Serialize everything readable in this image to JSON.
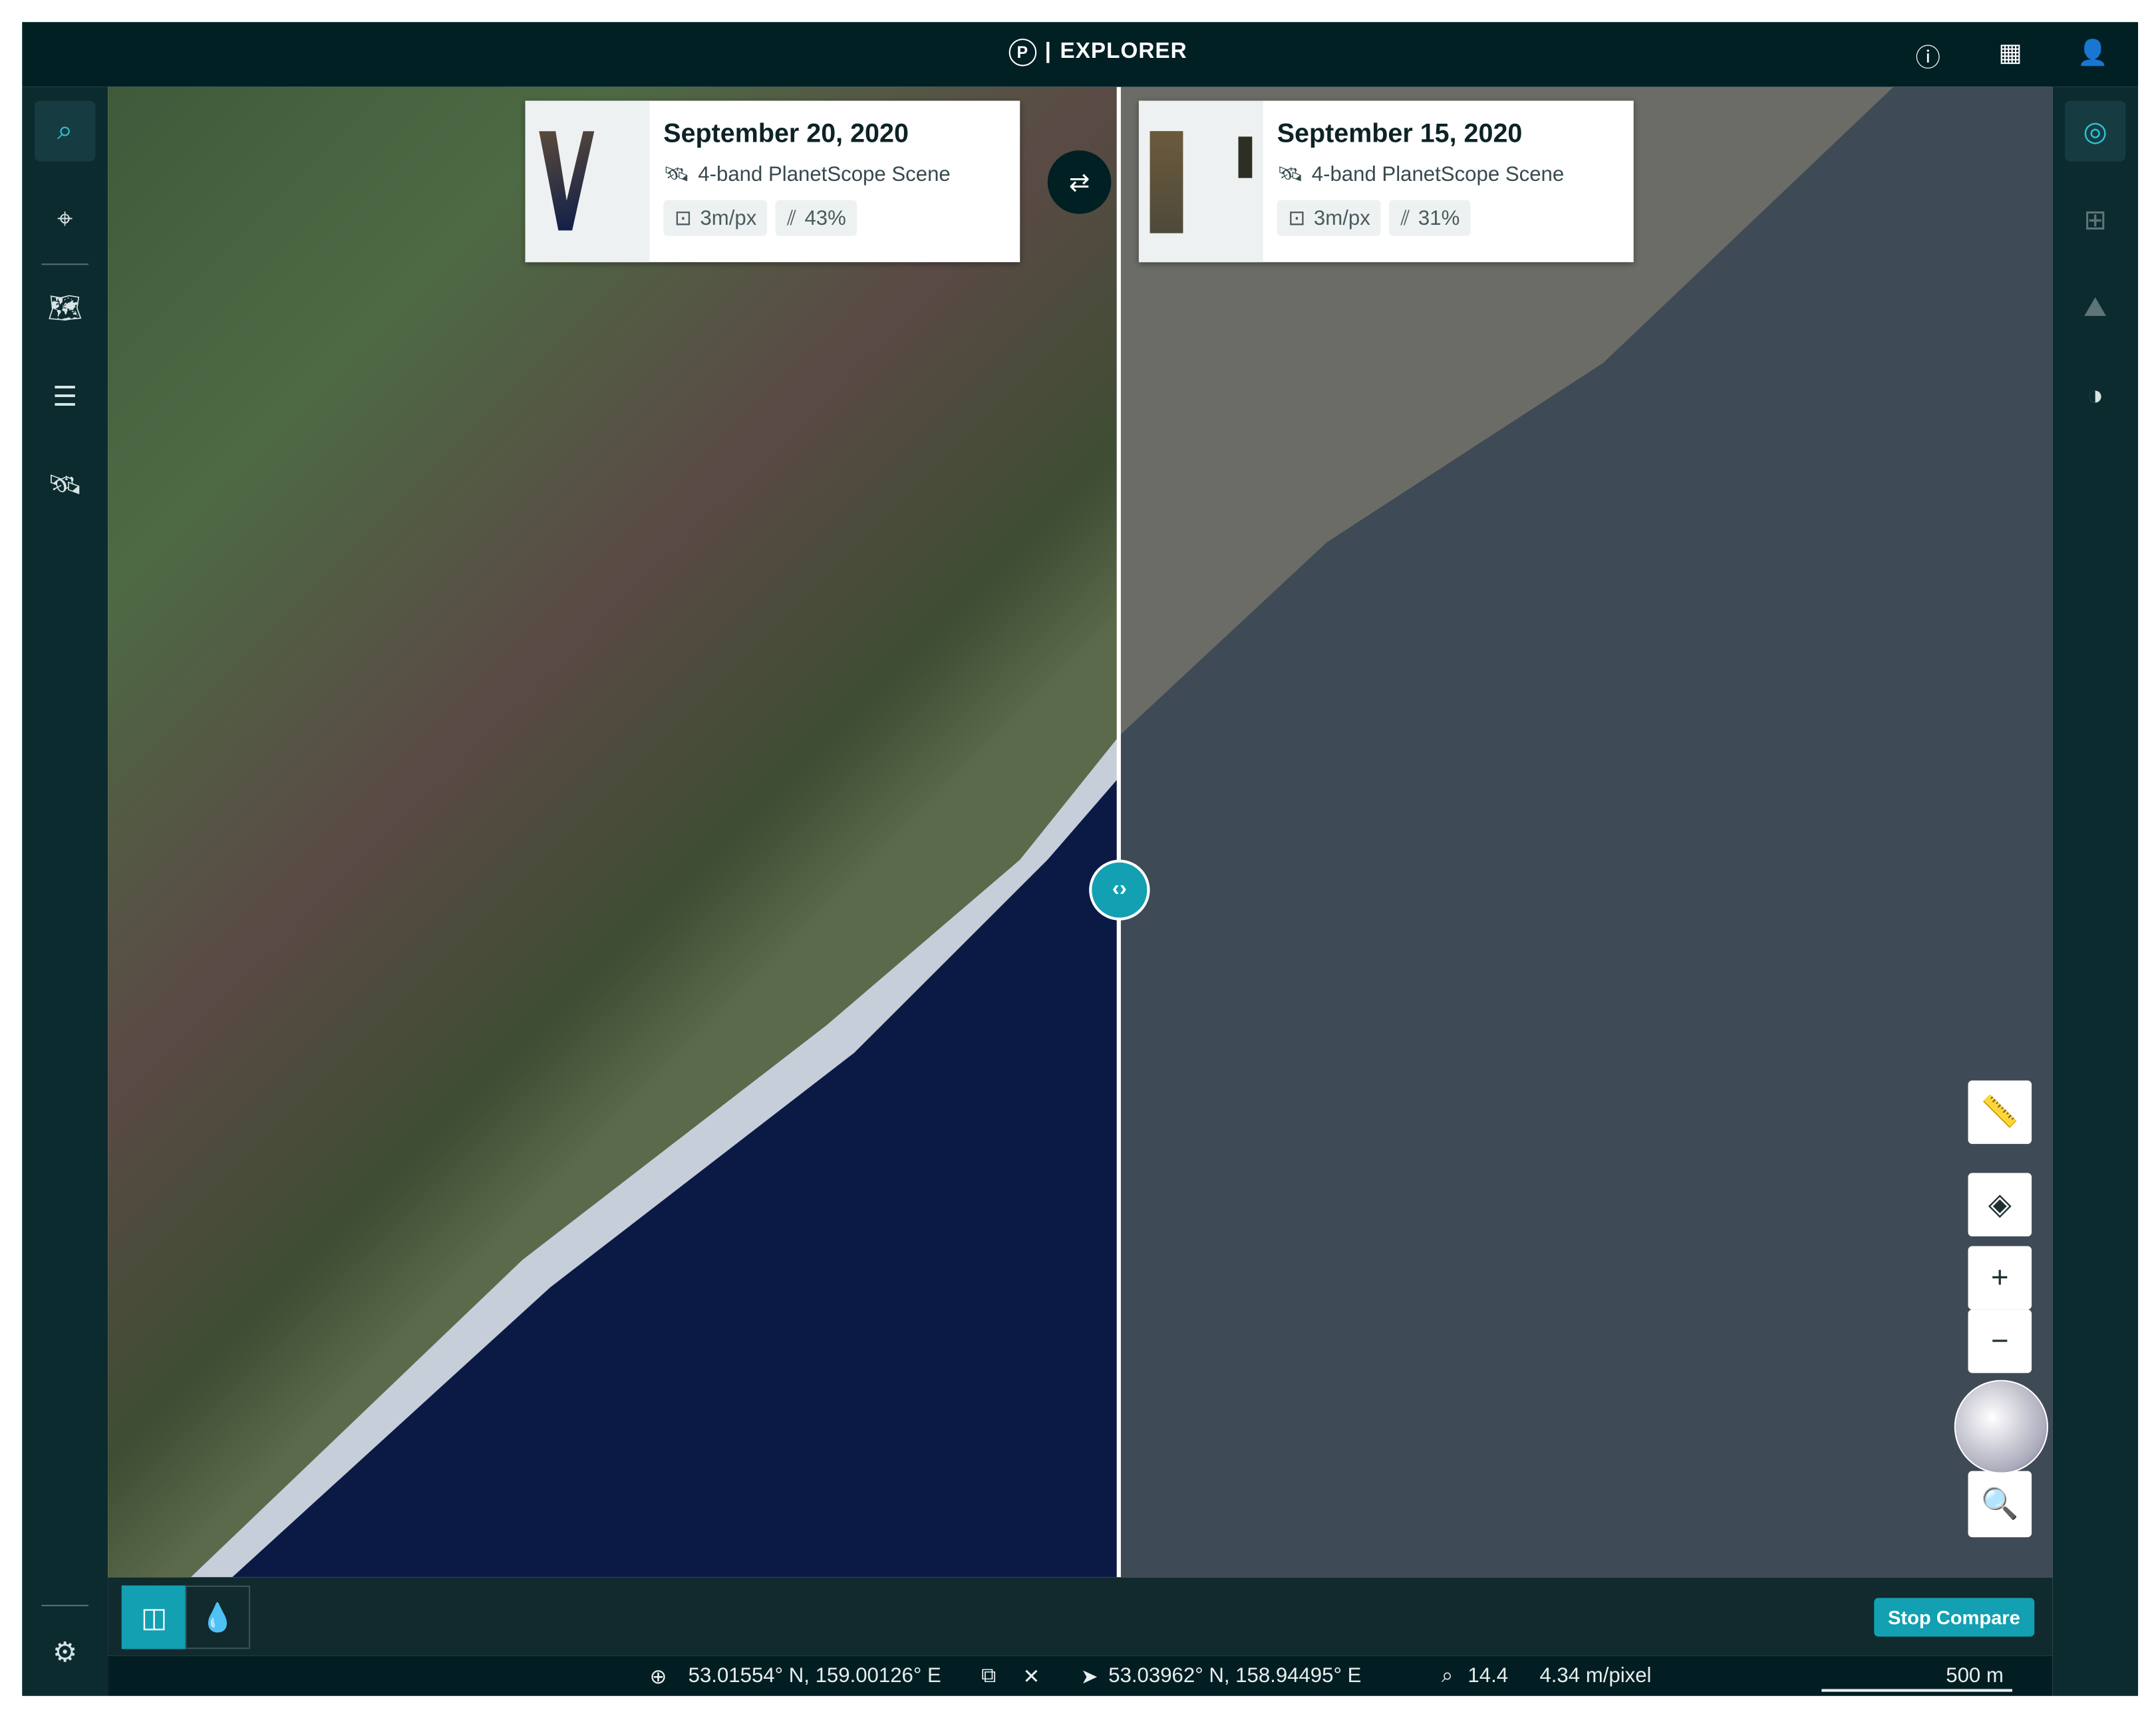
{
  "app": {
    "title": "EXPLORER",
    "logo_letter": "P"
  },
  "header": {
    "icons": [
      "help-icon",
      "apps-grid-icon",
      "user-icon"
    ]
  },
  "left_sidebar": {
    "items": [
      "search-icon",
      "location-pin-icon",
      "saved-map-icon",
      "orders-list-icon",
      "satellite-tasking-icon"
    ],
    "settings": "gear-icon"
  },
  "right_sidebar": {
    "items": [
      "imagery-globe-icon",
      "add-layer-icon",
      "elevation-icon",
      "time-contrast-icon"
    ]
  },
  "compare": {
    "left_scene": {
      "date": "September 20, 2020",
      "type": "4-band PlanetScope Scene",
      "resolution": "3m/px",
      "cloud_cover": "43%"
    },
    "right_scene": {
      "date": "September 15, 2020",
      "type": "4-band PlanetScope Scene",
      "resolution": "3m/px",
      "cloud_cover": "31%"
    },
    "swap_icon": "⇄",
    "handle_icon": "‹›"
  },
  "map_controls": {
    "zoom_in": "+",
    "zoom_out": "−"
  },
  "bottom_toolbar": {
    "stop_compare": "Stop Compare"
  },
  "status": {
    "cursor_coords": "53.01554° N, 159.00126° E",
    "center_coords": "53.03962° N, 158.94495° E",
    "zoom": "14.4",
    "resolution": "4.34 m/pixel",
    "scale": "500 m",
    "close": "✕"
  },
  "colors": {
    "accent": "#12a0b2",
    "header": "#012024"
  }
}
